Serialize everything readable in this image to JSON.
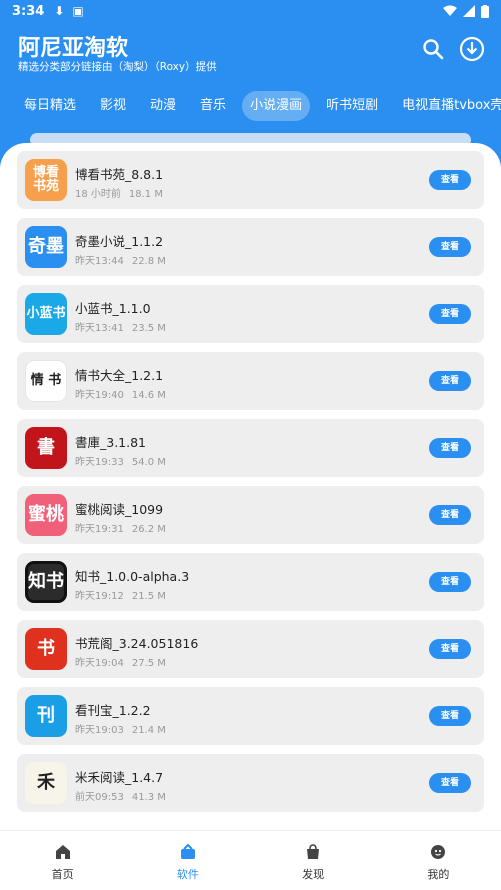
{
  "status": {
    "time": "3:34"
  },
  "app": {
    "title": "阿尼亚淘软",
    "subtitle": "精选分类部分链接由（淘梨）（Roxy）提供"
  },
  "tabs": [
    {
      "label": "每日精选",
      "active": false
    },
    {
      "label": "影视",
      "active": false
    },
    {
      "label": "动漫",
      "active": false
    },
    {
      "label": "音乐",
      "active": false
    },
    {
      "label": "小说漫画",
      "active": true
    },
    {
      "label": "听书短剧",
      "active": false
    },
    {
      "label": "电视直播tvbox壳子",
      "active": false
    }
  ],
  "items": [
    {
      "name": "博看书苑_8.8.1",
      "time": "18 小时前",
      "size": "18.1 M",
      "icon_text": "博看\n书苑",
      "icon_color": "#f6a04d",
      "button": "查看"
    },
    {
      "name": "奇墨小说_1.1.2",
      "time": "昨天13:44",
      "size": "22.8 M",
      "icon_text": "奇墨",
      "icon_color": "#2a8ff0",
      "button": "查看"
    },
    {
      "name": "小蓝书_1.1.0",
      "time": "昨天13:41",
      "size": "23.5 M",
      "icon_text": "小蓝书",
      "icon_color": "#1aa8e6",
      "button": "查看"
    },
    {
      "name": "情书大全_1.2.1",
      "time": "昨天19:40",
      "size": "14.6 M",
      "icon_text": "情 书",
      "icon_color": "#ffffff",
      "button": "查看"
    },
    {
      "name": "書庫_3.1.81",
      "time": "昨天19:33",
      "size": "54.0 M",
      "icon_text": "書",
      "icon_color": "#c2151b",
      "button": "查看"
    },
    {
      "name": "蜜桃阅读_1099",
      "time": "昨天19:31",
      "size": "26.2 M",
      "icon_text": "蜜桃",
      "icon_color": "#f06078",
      "button": "查看"
    },
    {
      "name": "知书_1.0.0-alpha.3",
      "time": "昨天19:12",
      "size": "21.5 M",
      "icon_text": "知书",
      "icon_color": "#2b2b2b",
      "button": "查看"
    },
    {
      "name": "书荒阁_3.24.051816",
      "time": "昨天19:04",
      "size": "27.5 M",
      "icon_text": "书",
      "icon_color": "#e0301e",
      "button": "查看"
    },
    {
      "name": "看刊宝_1.2.2",
      "time": "昨天19:03",
      "size": "21.4 M",
      "icon_text": "刊",
      "icon_color": "#1a9fe6",
      "button": "查看"
    },
    {
      "name": "米禾阅读_1.4.7",
      "time": "前天09:53",
      "size": "41.3 M",
      "icon_text": "禾",
      "icon_color": "#f7f4ea",
      "button": "查看"
    }
  ],
  "nav": [
    {
      "label": "首页",
      "active": false
    },
    {
      "label": "软件",
      "active": true
    },
    {
      "label": "发现",
      "active": false
    },
    {
      "label": "我的",
      "active": false
    }
  ]
}
